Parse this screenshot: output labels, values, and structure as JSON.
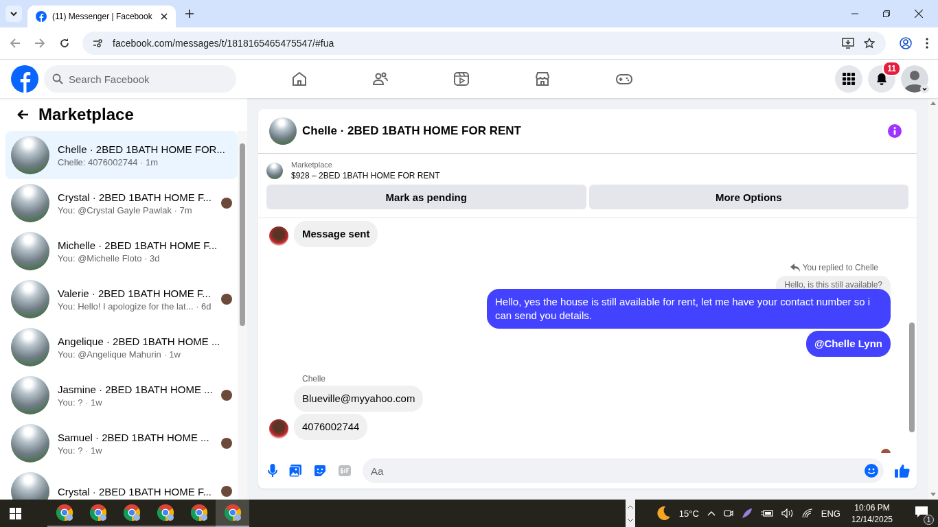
{
  "browser": {
    "tabs": [
      {
        "title": "(11) Messenger | Facebook",
        "selected": true
      }
    ],
    "url": "facebook.com/messages/t/1818165465475547/#fua"
  },
  "topbar": {
    "search_placeholder": "Search Facebook",
    "notification_count": "11"
  },
  "sidebar": {
    "title": "Marketplace",
    "conversations": [
      {
        "title": "Chelle · 2BED 1BATH HOME FOR...",
        "preview": "Chelle: 4076002744 · 1m",
        "selected": true,
        "seen_avatar": false
      },
      {
        "title": "Crystal · 2BED 1BATH HOME F...",
        "preview": "You: @Crystal Gayle Pawlak · 7m",
        "selected": false,
        "seen_avatar": true
      },
      {
        "title": "Michelle · 2BED 1BATH HOME F...",
        "preview": "You: @Michelle Floto · 3d",
        "selected": false,
        "seen_avatar": false
      },
      {
        "title": "Valerie · 2BED 1BATH HOME F...",
        "preview": "You: Hello! I apologize for the lat... · 6d",
        "selected": false,
        "seen_avatar": true
      },
      {
        "title": "Angelique · 2BED 1BATH HOME ...",
        "preview": "You: @Angelique Mahurin · 1w",
        "selected": false,
        "seen_avatar": false
      },
      {
        "title": "Jasmine · 2BED 1BATH HOME ...",
        "preview": "You: ? · 1w",
        "selected": false,
        "seen_avatar": true
      },
      {
        "title": "Samuel · 2BED 1BATH HOME ...",
        "preview": "You: ? · 1w",
        "selected": false,
        "seen_avatar": true
      },
      {
        "title": "Crystal · 2BED 1BATH HOME F...",
        "selected": false,
        "seen_avatar": true
      }
    ]
  },
  "chat": {
    "title": "Chelle · 2BED 1BATH HOME FOR RENT",
    "listing": {
      "label": "Marketplace",
      "title": "$928 – 2BED 1BATH HOME FOR RENT"
    },
    "actions": [
      "Mark as pending",
      "More Options"
    ],
    "messages": [
      {
        "kind": "incoming",
        "text": "Message sent",
        "bold": true,
        "avatar": true
      },
      {
        "kind": "reply_context",
        "label": "You replied to Chelle",
        "quote": "Hello, is this still available?"
      },
      {
        "kind": "outgoing",
        "text": "Hello, yes the house is still available for rent, let me have your contact number so i can send you details.",
        "bold": false
      },
      {
        "kind": "outgoing",
        "text": "@Chelle Lynn",
        "bold": true
      },
      {
        "kind": "sender",
        "text": "Chelle"
      },
      {
        "kind": "incoming",
        "text": "Blueville@myyahoo.com",
        "bold": false,
        "avatar": false
      },
      {
        "kind": "incoming",
        "text": "4076002744",
        "bold": false,
        "avatar": true
      }
    ],
    "composer_placeholder": "Aa"
  },
  "taskbar": {
    "apps": [
      {
        "selected": false
      },
      {
        "selected": false
      },
      {
        "selected": false
      },
      {
        "selected": false
      },
      {
        "selected": false
      },
      {
        "selected": true
      }
    ],
    "temperature": "15°C",
    "language": "ENG",
    "time": "10:06 PM",
    "date": "12/14/2025",
    "notification_count": "1"
  }
}
